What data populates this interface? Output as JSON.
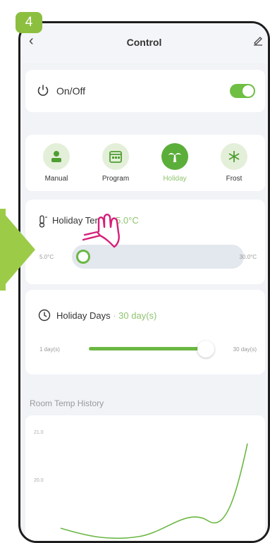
{
  "step": "4",
  "header": {
    "title": "Control"
  },
  "power": {
    "label": "On/Off",
    "on": true
  },
  "modes": [
    {
      "label": "Manual",
      "icon": "person-icon",
      "active": false
    },
    {
      "label": "Program",
      "icon": "calendar-icon",
      "active": false
    },
    {
      "label": "Holiday",
      "icon": "palm-icon",
      "active": true
    },
    {
      "label": "Frost",
      "icon": "snowflake-icon",
      "active": false
    }
  ],
  "holiday_temp": {
    "title": "Holiday Temp",
    "value": "5.0°C",
    "min": "5.0°C",
    "max": "30.0°C"
  },
  "holiday_days": {
    "title": "Holiday Days",
    "value": "30 day(s)",
    "min": "1 day(s)",
    "max": "30 day(s)"
  },
  "history": {
    "title": "Room Temp History",
    "y_ticks": [
      "21.0",
      "20.0"
    ]
  },
  "colors": {
    "accent": "#6bb743",
    "step_badge": "#8cbf3f",
    "pointer": "#d61f7a"
  }
}
